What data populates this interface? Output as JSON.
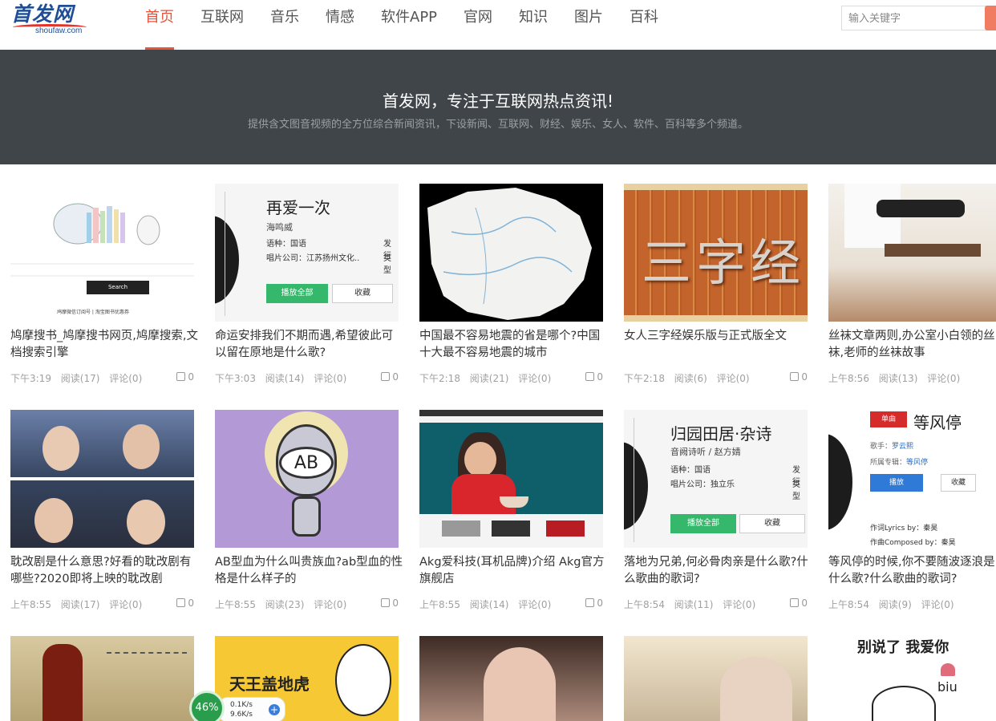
{
  "site": {
    "logo_text": "首发网",
    "logo_domain": "shoufaw.com"
  },
  "nav": {
    "items": [
      {
        "label": "首页",
        "active": true
      },
      {
        "label": "互联网",
        "active": false
      },
      {
        "label": "音乐",
        "active": false
      },
      {
        "label": "情感",
        "active": false
      },
      {
        "label": "软件APP",
        "active": false
      },
      {
        "label": "官网",
        "active": false
      },
      {
        "label": "知识",
        "active": false
      },
      {
        "label": "图片",
        "active": false
      },
      {
        "label": "百科",
        "active": false
      }
    ],
    "accent_color": "#e8523a"
  },
  "search": {
    "placeholder": "输入关键字"
  },
  "banner": {
    "title": "首发网，专注于互联网热点资讯!",
    "subtitle": "提供含文图音视频的全方位综合新闻资讯，下设新闻、互联网、财经、娱乐、女人、软件、百科等多个频道。"
  },
  "thumb_text": {
    "search_button": "Search",
    "search_footer": "鸠摩微信订阅号 | 淘宝图书优惠券",
    "song1_title": "再爱一次",
    "song1_artist": "海鸣威",
    "song1_lang": "语种：国语",
    "song1_label": "唱片公司：江苏扬州文化..",
    "song1_extra1": "发行",
    "song1_extra2": "类型",
    "play_all": "播放全部",
    "favorite": "收藏",
    "sanzijing": "三字经",
    "song2_title": "归园田居·杂诗",
    "song2_artist": "音阙诗听 / 赵方婧",
    "song2_lang": "语种：国语",
    "song2_label": "唱片公司：独立乐",
    "song3_tag": "单曲",
    "song3_title": "等风停",
    "song3_singer_label": "歌手：",
    "song3_singer": "罗云熙",
    "song3_album_label": "所属专辑：",
    "song3_album": "等风停",
    "song3_play": "播放",
    "song3_fav": "收藏",
    "song3_lyrics": "作词Lyrics by：秦昊",
    "song3_composed": "作曲Composed by：秦昊",
    "ab_text": "AB",
    "yellow_text": "天王盖地虎",
    "text_card": "别说了 我爱你",
    "text_card_small": "biu"
  },
  "cards": [
    {
      "title": "鸠摩搜书_鸠摩搜书网页,鸠摩搜索,文档搜索引擎",
      "time": "下午3:19",
      "reads": "阅读(17)",
      "comments": "评论(0)",
      "likes": "0"
    },
    {
      "title": "命运安排我们不期而遇,希望彼此可以留在原地是什么歌?",
      "time": "下午3:03",
      "reads": "阅读(14)",
      "comments": "评论(0)",
      "likes": "0"
    },
    {
      "title": "中国最不容易地震的省是哪个?中国十大最不容易地震的城市",
      "time": "下午2:18",
      "reads": "阅读(21)",
      "comments": "评论(0)",
      "likes": "0"
    },
    {
      "title": "女人三字经娱乐版与正式版全文",
      "time": "下午2:18",
      "reads": "阅读(6)",
      "comments": "评论(0)",
      "likes": "0"
    },
    {
      "title": "丝袜文章两则,办公室小白领的丝袜,老师的丝袜故事",
      "time": "上午8:56",
      "reads": "阅读(13)",
      "comments": "评论(0)",
      "likes": ""
    },
    {
      "title": "耽改剧是什么意思?好看的耽改剧有哪些?2020即将上映的耽改剧",
      "time": "上午8:55",
      "reads": "阅读(17)",
      "comments": "评论(0)",
      "likes": "0"
    },
    {
      "title": "AB型血为什么叫贵族血?ab型血的性格是什么样子的",
      "time": "上午8:55",
      "reads": "阅读(23)",
      "comments": "评论(0)",
      "likes": "0"
    },
    {
      "title": "Akg爱科技(耳机品牌)介绍 Akg官方旗舰店",
      "time": "上午8:55",
      "reads": "阅读(14)",
      "comments": "评论(0)",
      "likes": "0"
    },
    {
      "title": "落地为兄弟,何必骨肉亲是什么歌?什么歌曲的歌词?",
      "time": "上午8:54",
      "reads": "阅读(11)",
      "comments": "评论(0)",
      "likes": "0"
    },
    {
      "title": "等风停的时候,你不要随波逐浪是什么歌?什么歌曲的歌词?",
      "time": "上午8:54",
      "reads": "阅读(9)",
      "comments": "评论(0)",
      "likes": ""
    }
  ],
  "widget": {
    "percent": "46%",
    "up_speed": "0.1K/s",
    "down_speed": "9.6K/s",
    "plus": "+"
  }
}
